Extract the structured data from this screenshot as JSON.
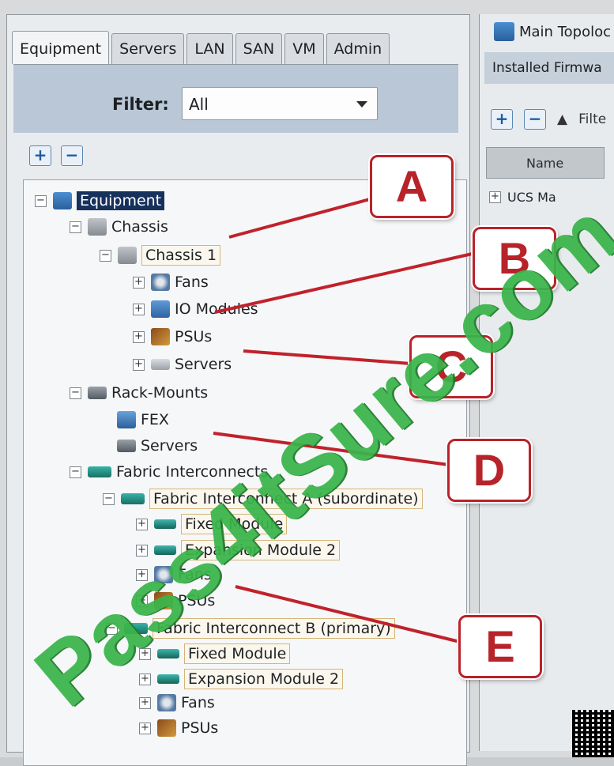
{
  "tabs": [
    "Equipment",
    "Servers",
    "LAN",
    "SAN",
    "VM",
    "Admin"
  ],
  "filter": {
    "label": "Filter:",
    "value": "All"
  },
  "toolbar": {
    "expand": "+",
    "collapse": "−"
  },
  "tree": {
    "root": "Equipment",
    "chassis": "Chassis",
    "chassis1": "Chassis 1",
    "fans": "Fans",
    "io_modules": "IO Modules",
    "psus": "PSUs",
    "servers": "Servers",
    "rack_mounts": "Rack-Mounts",
    "fex": "FEX",
    "rack_servers": "Servers",
    "fabric_interconnects": "Fabric Interconnects",
    "fi_a": "Fabric Interconnect A (subordinate)",
    "fi_a_fixed": "Fixed Module",
    "fi_a_expansion": "Expansion Module 2",
    "fi_a_fans": "Fans",
    "fi_a_psus": "PSUs",
    "fi_b": "Fabric Interconnect B (primary)",
    "fi_b_fixed": "Fixed Module",
    "fi_b_expansion": "Expansion Module 2",
    "fi_b_fans": "Fans",
    "fi_b_psus": "PSUs"
  },
  "right_panel": {
    "title": "Main Topoloc",
    "tab": "Installed Firmwa",
    "filter_text": "Filte",
    "column_header": "Name",
    "row_text": "UCS Ma"
  },
  "callouts": [
    "A",
    "B",
    "C",
    "D",
    "E"
  ],
  "watermark": "Pass4itSure.com",
  "colors": {
    "callout_red": "#b8232a",
    "watermark_green": "#39b54a",
    "selection_navy": "#16315c"
  }
}
